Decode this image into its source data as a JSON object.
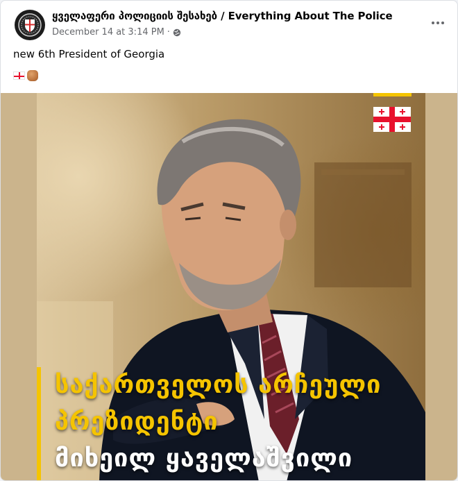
{
  "post": {
    "page_name": "ყველაფერი პოლიციის შესახებ / Everything About The Police",
    "timestamp": "December 14 at 3:14 PM",
    "separator": "·",
    "audience_icon": "globe-icon",
    "more_icon": "more-options-icon",
    "text": "new 6th President of Georgia",
    "emojis": [
      "georgia-flag-emoji",
      "fist-emoji"
    ]
  },
  "image": {
    "headline_line1": "საქართველოს არჩეული",
    "headline_line2": "პრეზიდენტი",
    "headline_line3": "მიხეილ ყაველაშვილი",
    "flag_icon": "georgia-flag-icon",
    "accent_color": "#f5c400",
    "flag_red": "#e8112d"
  }
}
